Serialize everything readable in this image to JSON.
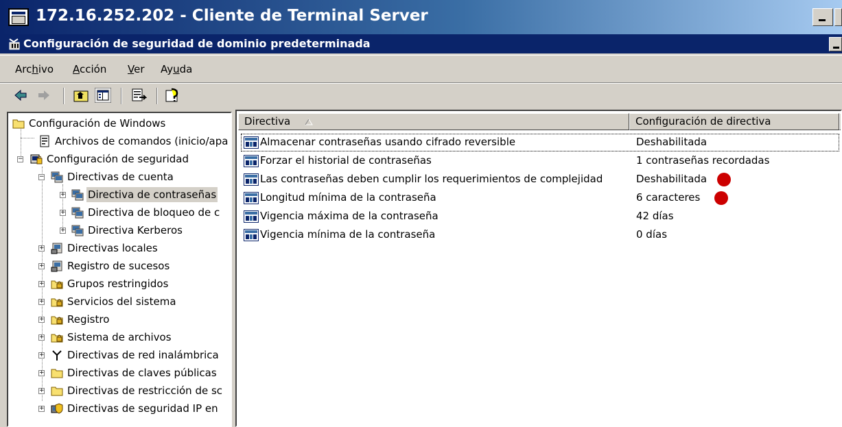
{
  "window": {
    "title": "172.16.252.202 - Cliente de Terminal Server"
  },
  "console": {
    "title": "Configuración de seguridad de dominio predeterminada"
  },
  "menu": [
    {
      "pre": "Arc",
      "key": "h",
      "post": "ivo"
    },
    {
      "pre": "",
      "key": "A",
      "post": "cción"
    },
    {
      "pre": "",
      "key": "V",
      "post": "er"
    },
    {
      "pre": "Ay",
      "key": "u",
      "post": "da"
    }
  ],
  "toolbar": [
    "back-arrow-icon",
    "forward-arrow-icon",
    "up-folder-icon",
    "show-hide-tree-icon",
    "export-list-icon",
    "help-icon"
  ],
  "tree": [
    {
      "label": "Configuración de Windows",
      "icon": "folder-icon"
    },
    {
      "label": "Archivos de comandos (inicio/apa",
      "icon": "script-icon"
    },
    {
      "label": "Configuración de seguridad",
      "icon": "security-settings-icon"
    },
    {
      "label": "Directivas de cuenta",
      "icon": "policy-folder-icon"
    },
    {
      "label": "Directiva de contraseñas",
      "icon": "policy-folder-icon"
    },
    {
      "label": "Directiva de bloqueo de c",
      "icon": "policy-folder-icon"
    },
    {
      "label": "Directiva Kerberos",
      "icon": "policy-folder-icon"
    },
    {
      "label": "Directivas locales",
      "icon": "policy-folder-icon"
    },
    {
      "label": "Registro de sucesos",
      "icon": "policy-folder-icon"
    },
    {
      "label": "Grupos restringidos",
      "icon": "locked-folder-icon"
    },
    {
      "label": "Servicios del sistema",
      "icon": "locked-folder-icon"
    },
    {
      "label": "Registro",
      "icon": "locked-folder-icon"
    },
    {
      "label": "Sistema de archivos",
      "icon": "locked-folder-icon"
    },
    {
      "label": "Directivas de red inalámbrica",
      "icon": "antenna-icon"
    },
    {
      "label": "Directivas de claves públicas",
      "icon": "folder-icon"
    },
    {
      "label": "Directivas de restricción de sc",
      "icon": "folder-icon"
    },
    {
      "label": "Directivas de seguridad IP en",
      "icon": "ip-security-icon"
    }
  ],
  "list": {
    "columns": [
      "Directiva",
      "Configuración de directiva"
    ],
    "rows": [
      {
        "policy": "Almacenar contraseñas usando cifrado reversible",
        "setting": "Deshabilitada",
        "flag": false
      },
      {
        "policy": "Forzar el historial de contraseñas",
        "setting": "1 contraseñas recordadas",
        "flag": false
      },
      {
        "policy": "Las contraseñas deben cumplir los requerimientos de complejidad",
        "setting": "Deshabilitada",
        "flag": true
      },
      {
        "policy": "Longitud mínima de la contraseña",
        "setting": "6 caracteres",
        "flag": true
      },
      {
        "policy": "Vigencia máxima de la contraseña",
        "setting": "42 días",
        "flag": false
      },
      {
        "policy": "Vigencia mínima de la contraseña",
        "setting": "0 días",
        "flag": false
      }
    ]
  },
  "colors": {
    "titlebar": "#0a246a",
    "flag": "#cc0000",
    "chrome": "#d4d0c8"
  }
}
